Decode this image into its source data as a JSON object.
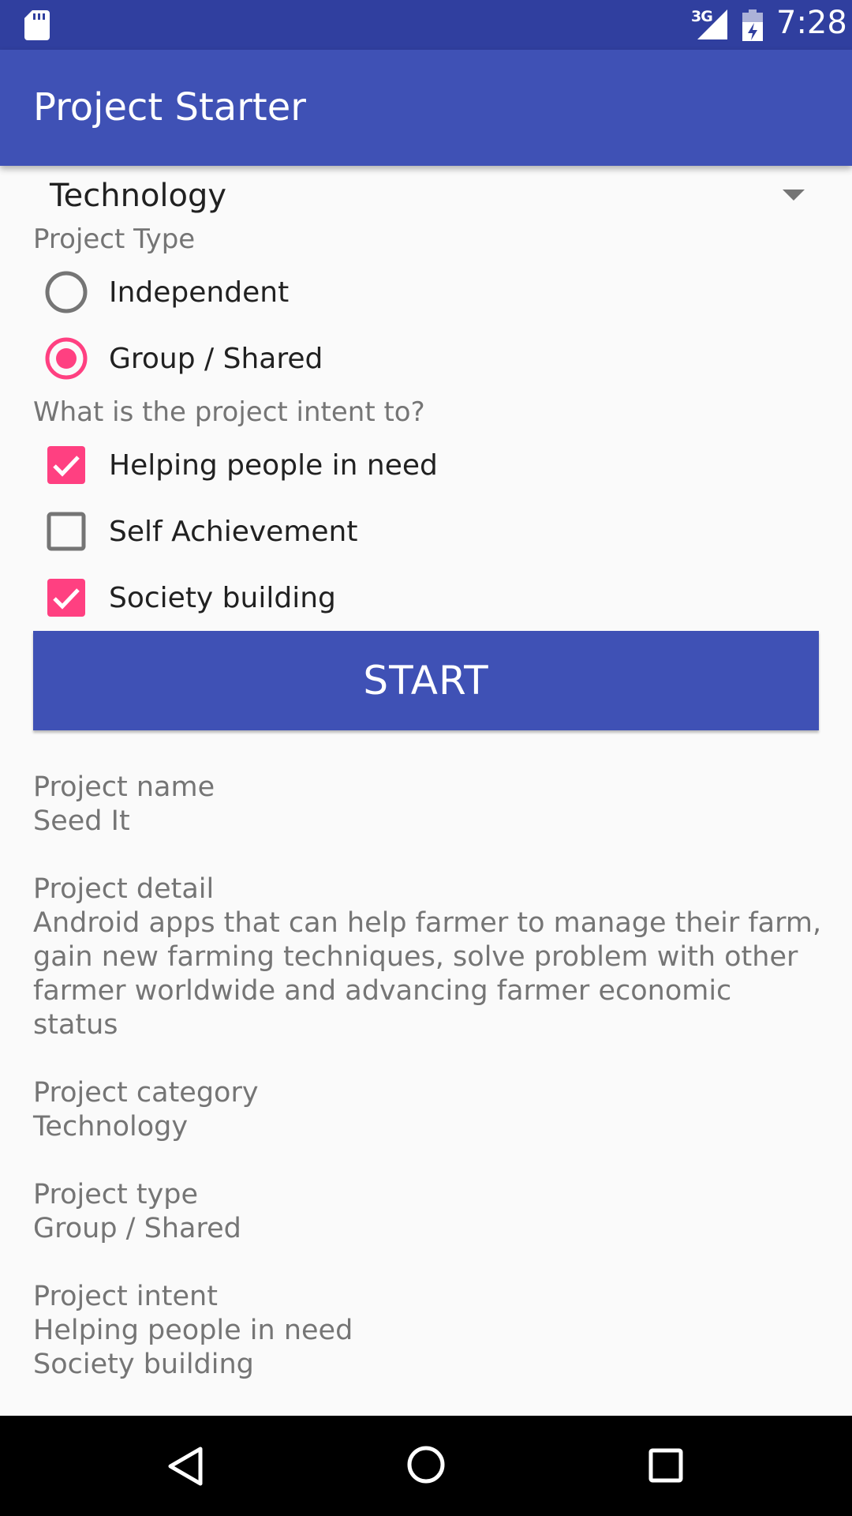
{
  "status_bar": {
    "time": "7:28",
    "network": "3G",
    "icons": [
      "sd-card-icon",
      "signal-icon",
      "battery-charging-icon"
    ]
  },
  "app_bar": {
    "title": "Project Starter"
  },
  "category": {
    "selected": "Technology"
  },
  "project_type": {
    "label": "Project Type",
    "options": [
      {
        "label": "Independent",
        "selected": false
      },
      {
        "label": "Group / Shared",
        "selected": true
      }
    ]
  },
  "intent": {
    "label": "What is the project intent to?",
    "options": [
      {
        "label": "Helping people in need",
        "checked": true
      },
      {
        "label": "Self Achievement",
        "checked": false
      },
      {
        "label": "Society building",
        "checked": true
      }
    ]
  },
  "start_button": {
    "label": "START"
  },
  "summary": {
    "name_label": "Project name",
    "name_value": "Seed It",
    "detail_label": "Project detail",
    "detail_value": "Android apps that can help farmer to manage their farm, gain new farming techniques, solve problem with other farmer worldwide and advancing farmer economic status",
    "category_label": "Project category",
    "category_value": "Technology",
    "type_label": "Project type",
    "type_value": "Group / Shared",
    "intent_label": "Project intent",
    "intent_values": [
      "Helping people in need",
      "Society building"
    ]
  },
  "colors": {
    "primary": "#3f51b5",
    "primary_dark": "#303f9f",
    "accent": "#ff4081"
  }
}
